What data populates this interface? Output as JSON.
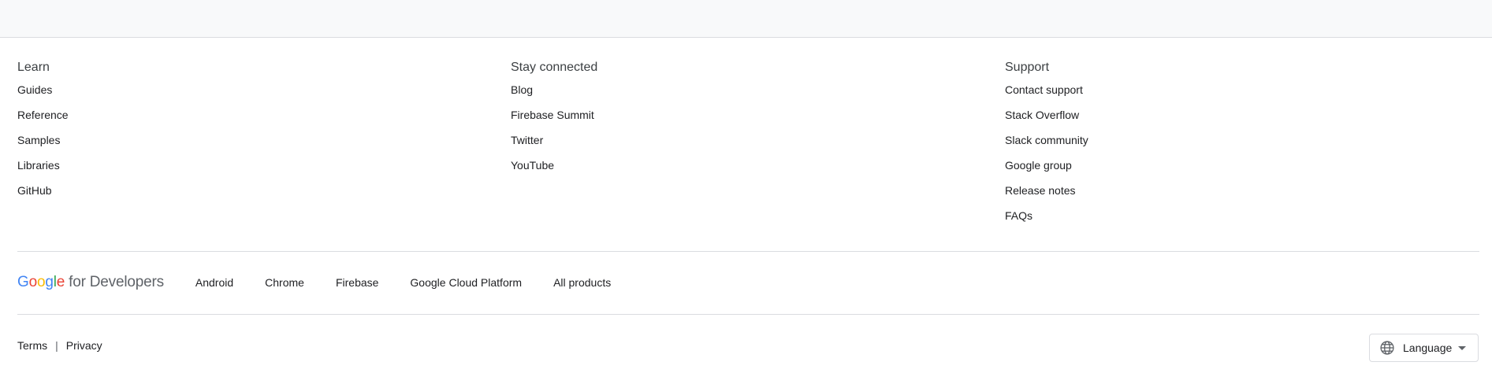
{
  "footer": {
    "columns": [
      {
        "title": "Learn",
        "links": [
          "Guides",
          "Reference",
          "Samples",
          "Libraries",
          "GitHub"
        ]
      },
      {
        "title": "Stay connected",
        "links": [
          "Blog",
          "Firebase Summit",
          "Twitter",
          "YouTube"
        ]
      },
      {
        "title": "Support",
        "links": [
          "Contact support",
          "Stack Overflow",
          "Slack community",
          "Google group",
          "Release notes",
          "FAQs"
        ]
      }
    ],
    "brand": {
      "logo_g1": "G",
      "logo_g2": "o",
      "logo_g3": "o",
      "logo_g4": "g",
      "logo_g5": "l",
      "logo_g6": "e",
      "logo_rest": "for Developers"
    },
    "products": [
      "Android",
      "Chrome",
      "Firebase",
      "Google Cloud Platform",
      "All products"
    ],
    "legal": {
      "terms": "Terms",
      "separator": "|",
      "privacy": "Privacy"
    },
    "language_button": {
      "label": "Language",
      "icon": "globe-icon"
    }
  },
  "colors": {
    "band_bg": "#f8f9fa",
    "divider": "#dadce0",
    "text": "#202124"
  }
}
